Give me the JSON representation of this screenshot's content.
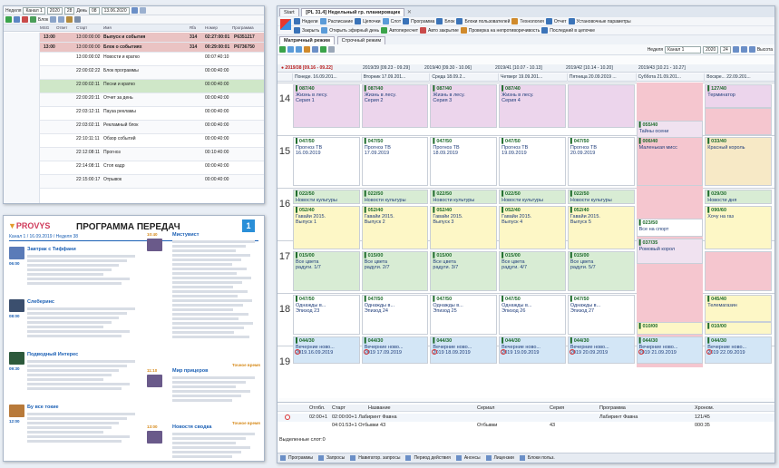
{
  "left_top": {
    "toolbar1": [
      "Канал 1",
      "2020",
      "28",
      "День",
      "08",
      "13.06.2020"
    ],
    "toolbar2": "Блок",
    "headers": [
      "MSG",
      "Ответ",
      "Старт",
      "Имя",
      "Rfa",
      "Номер",
      "Программа"
    ],
    "rows": [
      {
        "time": "13:00",
        "code": "13:00:00:00",
        "name": "Выпуск и события",
        "dur": "314",
        "num": "02:27:00:01",
        "prog": "Р6351217",
        "color": "#cf2b2b"
      },
      {
        "time": "13:00",
        "code": "13:00:00:00",
        "name": "Блок о событиях",
        "dur": "314",
        "num": "00:29:00:01",
        "prog": "Р6736750",
        "color": "#cf2b2b"
      },
      {
        "time": "",
        "code": "13:00:00:02",
        "name": "Новости и кратко",
        "dur": "",
        "num": "00:07:40:10",
        "prog": "",
        "color": ""
      },
      {
        "time": "",
        "code": "22:00:02:22",
        "name": "Блок программы",
        "dur": "",
        "num": "00:00:40:00",
        "prog": "",
        "color": ""
      },
      {
        "time": "",
        "code": "22:00:02:11",
        "name": "Песни и кратко",
        "dur": "",
        "num": "00:00:40:00",
        "prog": "",
        "color": ""
      },
      {
        "time": "",
        "code": "22:00:20:11",
        "name": "Отчет за день",
        "dur": "",
        "num": "00:00:40:00",
        "prog": "",
        "color": ""
      },
      {
        "time": "",
        "code": "22:03:12:11",
        "name": "Пауза рекламы",
        "dur": "",
        "num": "00:00:40:00",
        "prog": "",
        "color": ""
      },
      {
        "time": "",
        "code": "22:03:02:11",
        "name": "Рекламный блок",
        "dur": "",
        "num": "00:00:40:00",
        "prog": "",
        "color": ""
      },
      {
        "time": "",
        "code": "22:10:11:11",
        "name": "Обзор событий",
        "dur": "",
        "num": "00:00:40:00",
        "prog": "",
        "color": ""
      },
      {
        "time": "",
        "code": "22:12:08:11",
        "name": "Прогноз",
        "dur": "",
        "num": "00:10:40:00",
        "prog": "",
        "color": ""
      },
      {
        "time": "",
        "code": "22:14:08:11",
        "name": "Стоп кадр",
        "dur": "",
        "num": "00:00:40:00",
        "prog": "",
        "color": ""
      },
      {
        "time": "",
        "code": "22:15:00:17",
        "name": "Отрывок",
        "dur": "",
        "num": "00:00:40:00",
        "prog": "",
        "color": ""
      }
    ]
  },
  "guide": {
    "logo": "PROVYS",
    "title": "ПРОГРАММА ПЕРЕДАЧ",
    "badge": "1",
    "subtitle": "Канал 1 / 16.09.2019 / Неделя 38",
    "left_items": [
      {
        "time": "06:00",
        "title": "Завтрак с Тиффани"
      },
      {
        "time": "08:00",
        "title": "Слеберинс"
      },
      {
        "time": "09:30",
        "title": "Подводный Интерес"
      },
      {
        "time": "12:00",
        "title": "Бу все токие"
      }
    ],
    "right_items": [
      {
        "time": "10:40",
        "title": "Мистувист"
      },
      {
        "time": "11:10",
        "title": "Мир прицеров"
      },
      {
        "time": "13:00",
        "title": "Новостя сводка"
      }
    ],
    "tag": "Точное время"
  },
  "sched": {
    "tabs": [
      "Start",
      "[PL 31.4] Недельный гр. планировщик"
    ],
    "menu": [
      "Недели",
      "Расписание",
      "Цепочки",
      "Слот",
      "Программа",
      "Блок",
      "Блоки пользователей",
      "Технология",
      "Отчет",
      "Установочные параметры"
    ],
    "menu2": [
      "Закрыть",
      "Открыть эфирный день",
      "Автопересчет",
      "Авто закрытие",
      "Проверка на непротиворечивость",
      "Последний в цепочке"
    ],
    "mode_tabs": [
      "Матричный режим",
      "Строчный режим"
    ],
    "toolbar": {
      "label": "Неделя",
      "channel": "Канал 1",
      "year": "2020",
      "week": "24",
      "tail": "Высота"
    },
    "weeks": [
      "2019/38 [09.16 - 09.22]",
      "2019/39 [09.23 - 09.29]",
      "2019/40 [09.30 - 10.06]",
      "2019/41 [10.07 - 10.13]",
      "2019/42 [10.14 - 10.20]",
      "2019/43 [10.21 - 10.27]"
    ],
    "days": [
      "Понеде. 16.09.201...",
      "Вторник 17.09.201...",
      "Среда 18.09.2...",
      "Четверг 19.09.201...",
      "Пятница 20.09.2019 ...",
      "Суббота 21.09.201...",
      "Воскре... 22.09.201..."
    ],
    "hours": [
      "14",
      "15",
      "16",
      "17",
      "18",
      "19"
    ],
    "cells": {
      "r14": [
        {
          "code": "087/40",
          "title": "Жизнь в лесу.",
          "ep": "Серия 1"
        },
        {
          "code": "087/40",
          "title": "Жизнь в лесу.",
          "ep": "Серия 2"
        },
        {
          "code": "087/40",
          "title": "Жизнь в лесу.",
          "ep": "Серия 3"
        },
        {
          "code": "087/40",
          "title": "Жизнь в лесу.",
          "ep": "Серия 4"
        }
      ],
      "sat14": {
        "code": "055/40",
        "title": "Тайны осени"
      },
      "sun14": {
        "code": "127/40",
        "title": "Терминатор"
      },
      "r15": [
        {
          "code": "047/50",
          "title": "Прогноз ТВ",
          "ep": "16.09.2019"
        },
        {
          "code": "047/50",
          "title": "Прогноз ТВ",
          "ep": "17.09.2019"
        },
        {
          "code": "047/50",
          "title": "Прогноз ТВ",
          "ep": "18.09.2019"
        },
        {
          "code": "047/50",
          "title": "Прогноз ТВ",
          "ep": "19.09.2019"
        },
        {
          "code": "047/50",
          "title": "Прогноз ТВ",
          "ep": "20.09.2019"
        }
      ],
      "sat15": {
        "code": "006/40",
        "title": "Маленькая мисс"
      },
      "sun15": {
        "code": "033/40",
        "title": "Красный король"
      },
      "r16": {
        "code": "022/50",
        "title": "Новости культуры"
      },
      "r16b": [
        {
          "code": "052/40",
          "title": "Гавайи 2015.",
          "ep": "Выпуск 1"
        },
        {
          "code": "052/40",
          "title": "Гавайи 2015.",
          "ep": "Выпуск 2"
        },
        {
          "code": "052/40",
          "title": "Гавайи 2015.",
          "ep": "Выпуск 3"
        },
        {
          "code": "052/40",
          "title": "Гавайи 2015.",
          "ep": "Выпуск 4"
        },
        {
          "code": "052/40",
          "title": "Гавайи 2015.",
          "ep": "Выпуск 5"
        }
      ],
      "sun16": {
        "code": "029/30",
        "title": "Новости дня"
      },
      "sun16b": {
        "code": "090/60",
        "title": "Хочу на газ"
      },
      "sat16": {
        "code": "023/50",
        "title": "Все на спорт"
      },
      "sat17": {
        "code": "037/35",
        "title": "Ромовый корол"
      },
      "r17": [
        {
          "code": "015/00",
          "title": "Все цвета",
          "ep": "радуги. 1/7"
        },
        {
          "code": "015/00",
          "title": "Все цвета",
          "ep": "радуги. 2/7"
        },
        {
          "code": "015/00",
          "title": "Все цвета",
          "ep": "радуги. 3/7"
        },
        {
          "code": "015/00",
          "title": "Все цвета",
          "ep": "радуги. 4/7"
        },
        {
          "code": "015/00",
          "title": "Все цвета",
          "ep": "радуги. 5/7"
        }
      ],
      "r18": [
        {
          "code": "047/50",
          "title": "Однажды в...",
          "ep": "Эпизод 23"
        },
        {
          "code": "047/50",
          "title": "Однажды в...",
          "ep": "Эпизод 24"
        },
        {
          "code": "047/50",
          "title": "Однажды в...",
          "ep": "Эпизод 25"
        },
        {
          "code": "047/50",
          "title": "Однажды в...",
          "ep": "Эпизод 26"
        },
        {
          "code": "047/50",
          "title": "Однажды в...",
          "ep": "Эпизод 27"
        }
      ],
      "sun18": {
        "code": "045/40",
        "title": "Телемагазин"
      },
      "sat18": {
        "code": "010/00"
      },
      "sun18b": {
        "code": "010/00"
      },
      "r19": [
        {
          "code": "044/30",
          "title": "Вечерние ново...",
          "ep": "2019.16.09.2019"
        },
        {
          "code": "044/30",
          "title": "Вечерние ново...",
          "ep": "2019 17.09.2019"
        },
        {
          "code": "044/30",
          "title": "Вечерние ново...",
          "ep": "2019 18.09.2019"
        },
        {
          "code": "044/30",
          "title": "Вечерние ново...",
          "ep": "2019 19.09.2019"
        },
        {
          "code": "044/30",
          "title": "Вечерние ново...",
          "ep": "2019 20.09.2019"
        },
        {
          "code": "044/30",
          "title": "Вечерние ново...",
          "ep": "2019 21.09.2019"
        },
        {
          "code": "044/30",
          "title": "Вечерние ново...",
          "ep": "2019 22.09.2019"
        }
      ]
    },
    "bottom": {
      "headers": [
        "Отлбл.",
        "Старт",
        "Название",
        "Сериал",
        "Серия",
        "Программа",
        "Хроном."
      ],
      "rows": [
        [
          "02:00+1",
          "02:00:00+1 Лабиринт Фавна",
          "",
          "",
          "Лабиринт Фавна",
          "121/45"
        ],
        [
          "",
          "04:01:53+1 Отбывки 43",
          "Отбывки",
          "43",
          "",
          "000:35"
        ]
      ],
      "selected": "Выделенные слот:0",
      "statusbar": [
        "Программы",
        "Запросы",
        "Навигатор. запросы",
        "Период действия",
        "Анонсы",
        "Лицензии",
        "Блоки польз."
      ]
    }
  }
}
